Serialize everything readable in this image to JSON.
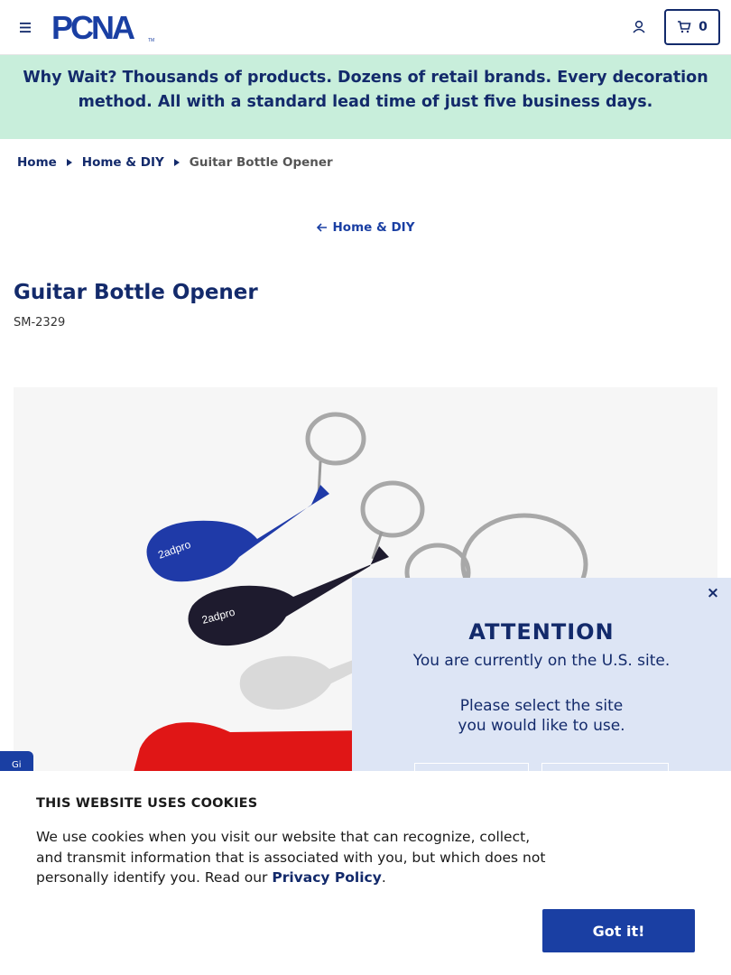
{
  "header": {
    "logo_text": "PCNA",
    "logo_tm": "TM",
    "cart_count": "0"
  },
  "promo": {
    "lead": "Why Wait?",
    "text": " Thousands of products. Dozens of retail brands. Every decoration method. All with a standard lead time of just five business days."
  },
  "breadcrumb": {
    "items": [
      {
        "label": "Home"
      },
      {
        "label": "Home & DIY"
      }
    ],
    "current": "Guitar Bottle Opener"
  },
  "back_link": "Home & DIY",
  "product": {
    "title": "Guitar Bottle Opener",
    "sku": "SM-2329",
    "engraving": "2adpro",
    "colors": {
      "blue": "#1f3aa8",
      "black": "#1e1b2e",
      "silver": "#d9d9d9",
      "red": "#e01616"
    }
  },
  "modal": {
    "close": "×",
    "title": "ATTENTION",
    "subtitle": "You are currently on the U.S. site.",
    "prompt": "Please select the site you would like to use."
  },
  "side_tab": "Gi",
  "cookie": {
    "title": "THIS WEBSITE USES COOKIES",
    "text": "We use cookies when you visit our website that can recognize, collect, and transmit information that is associated with you, but which does not personally identify you. Read our ",
    "link": "Privacy Policy",
    "period": ".",
    "button": "Got it!"
  },
  "colors": {
    "brand_navy": "#132a6b",
    "brand_blue": "#1a3fa3",
    "promo_bg": "#c8eedb",
    "modal_bg": "#dde5f5"
  }
}
